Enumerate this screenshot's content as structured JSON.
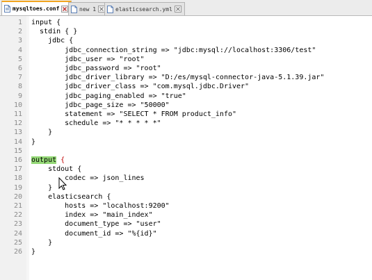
{
  "tabs": [
    {
      "label": "mysqltoes.conf",
      "active": true
    },
    {
      "label": "new 1",
      "active": false
    },
    {
      "label": "elasticsearch.yml",
      "active": false
    }
  ],
  "editor": {
    "line_numbers": [
      "1",
      "2",
      "3",
      "4",
      "5",
      "6",
      "7",
      "8",
      "9",
      "10",
      "11",
      "12",
      "13",
      "14",
      "15",
      "16",
      "17",
      "18",
      "19",
      "20",
      "21",
      "22",
      "23",
      "24",
      "25",
      "26"
    ],
    "lines": [
      "input {",
      "  stdin { }",
      "    jdbc {",
      "        jdbc_connection_string => \"jdbc:mysql://localhost:3306/test\"",
      "        jdbc_user => \"root\"",
      "        jdbc_password => \"root\"",
      "        jdbc_driver_library => \"D:/es/mysql-connector-java-5.1.39.jar\"",
      "        jdbc_driver_class => \"com.mysql.jdbc.Driver\"",
      "        jdbc_paging_enabled => \"true\"",
      "        jdbc_page_size => \"50000\"",
      "        statement => \"SELECT * FROM product_info\"",
      "        schedule => \"* * * * *\"",
      "    }",
      "}",
      "",
      "output {",
      "    stdout {",
      "        codec => json_lines",
      "    }",
      "    elasticsearch {",
      "        hosts => \"localhost:9200\"",
      "        index => \"main_index\"",
      "        document_type => \"user\"",
      "        document_id => \"%{id}\"",
      "    }",
      "}"
    ],
    "highlighted_word": "output",
    "colors": {
      "highlight": "#95d977",
      "active_tab_accent": "#f2a51f",
      "brace_match": "#c00000"
    }
  }
}
